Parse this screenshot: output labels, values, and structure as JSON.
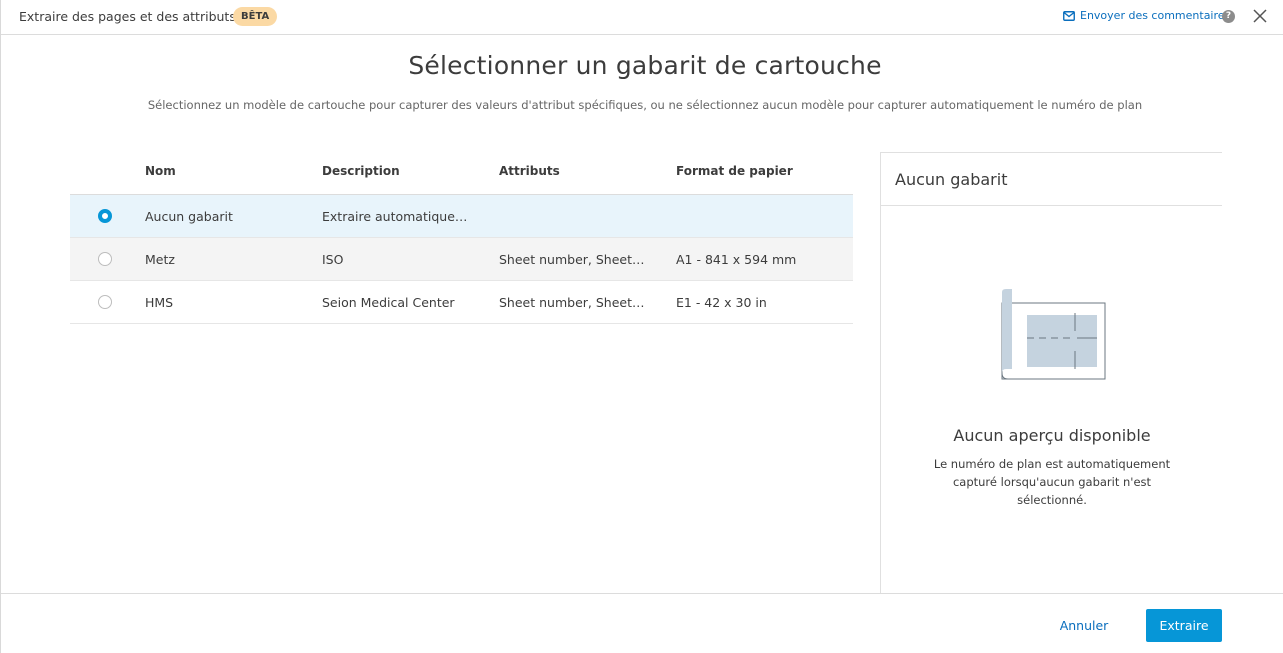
{
  "header": {
    "title": "Extraire des pages et des attributs",
    "badge": "BÊTA",
    "feedback_label": "Envoyer des commentaires",
    "help_icon": "help-icon",
    "close_icon": "close-icon"
  },
  "main": {
    "title": "Sélectionner un gabarit de cartouche",
    "subtitle": "Sélectionnez un modèle de cartouche pour capturer des valeurs d'attribut spécifiques, ou ne sélectionnez aucun modèle pour capturer automatiquement le numéro de plan"
  },
  "table": {
    "columns": [
      "Nom",
      "Description",
      "Attributs",
      "Format de papier"
    ],
    "rows": [
      {
        "name": "Aucun gabarit",
        "description": "Extraire automatiquem…",
        "attributes": "",
        "paper": "",
        "selected": true
      },
      {
        "name": "Metz",
        "description": "ISO",
        "attributes": "Sheet number, Sheet ti…",
        "paper": "A1 - 841 x 594 mm",
        "selected": false
      },
      {
        "name": "HMS",
        "description": "Seion Medical Center",
        "attributes": "Sheet number, Sheet ti…",
        "paper": "E1 - 42 x 30 in",
        "selected": false
      }
    ]
  },
  "preview": {
    "header": "Aucun gabarit",
    "title": "Aucun aperçu disponible",
    "description": "Le numéro de plan est automatiquement capturé lorsqu'aucun gabarit n'est sélectionné."
  },
  "footer": {
    "cancel_label": "Annuler",
    "extract_label": "Extraire"
  },
  "colors": {
    "accent": "#0696d7",
    "link": "#0a6ebd",
    "badge": "#fbd9a4",
    "selected_row": "#e8f4fb"
  }
}
